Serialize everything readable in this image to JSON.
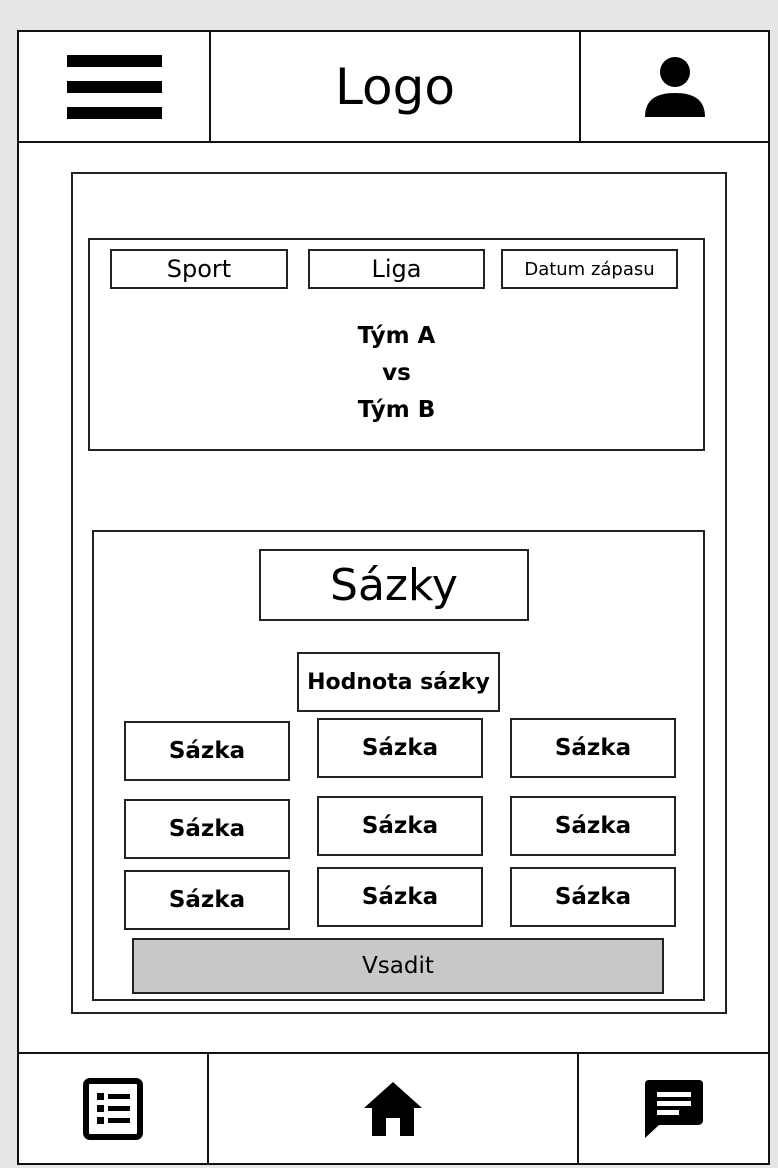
{
  "header": {
    "logo": "Logo",
    "menu_icon": "hamburger-menu-icon",
    "profile_icon": "user-profile-icon"
  },
  "match": {
    "sport": "Sport",
    "league": "Liga",
    "date": "Datum zápasu",
    "team_a": "Tým A",
    "versus": "vs",
    "team_b": "Tým B"
  },
  "bets": {
    "title": "Sázky",
    "value_label": "Hodnota sázky",
    "options": [
      [
        "Sázka",
        "Sázka",
        "Sázka"
      ],
      [
        "Sázka",
        "Sázka",
        "Sázka"
      ],
      [
        "Sázka",
        "Sázka",
        "Sázka"
      ]
    ],
    "submit_label": "Vsadit"
  },
  "footer": {
    "left_icon": "list-icon",
    "middle_icon": "home-icon",
    "right_icon": "chat-icon"
  },
  "colors": {
    "background": "#e6e6e6",
    "panel": "#ffffff",
    "button_disabled": "#c8c8c8"
  }
}
